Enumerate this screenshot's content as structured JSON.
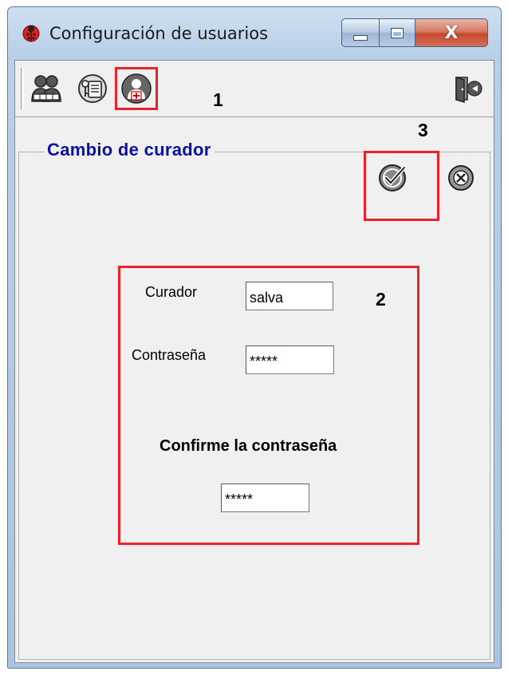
{
  "window": {
    "title": "Configuración de usuarios",
    "close_glyph": "X"
  },
  "toolbar": {
    "buttons": [
      {
        "icon": "users-group-icon"
      },
      {
        "icon": "user-key-icon"
      },
      {
        "icon": "curator-user-icon"
      },
      {
        "icon": "exit-door-icon"
      }
    ]
  },
  "annotations": {
    "marker_1": "1",
    "marker_2": "2",
    "marker_3": "3",
    "color": "#e8222a"
  },
  "panel": {
    "title": "Cambio de curador",
    "accept_icon": "checkmark-circle-icon",
    "cancel_icon": "cancel-circle-icon"
  },
  "form": {
    "curador_label": "Curador",
    "curador_value": "salva",
    "password_label": "Contraseña",
    "password_value": "*****",
    "confirm_label": "Confirme la contraseña",
    "confirm_value": "*****"
  },
  "colors": {
    "title_accent": "#0a11a8",
    "client_bg": "#f0f0f0"
  }
}
